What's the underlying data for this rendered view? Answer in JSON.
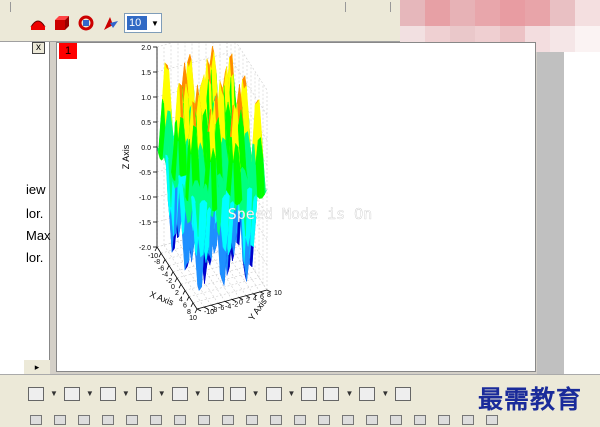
{
  "toolbar": {
    "icons": [
      "rotate-icon",
      "cube-icon",
      "reset-icon",
      "lighting-icon"
    ],
    "size_value": "10"
  },
  "left_panel": {
    "close_label": "x",
    "items": [
      "iew",
      "lor.",
      "Max",
      "lor."
    ]
  },
  "graph": {
    "layer_label": "1",
    "overlay_text": "Speed Mode is On",
    "chart_data": {
      "type": "surface",
      "xlabel": "X Axis",
      "ylabel": "Y Axis",
      "zlabel": "Z Axis",
      "xticks": [
        "-10",
        "-8",
        "-6",
        "-4",
        "-2",
        "0",
        "2",
        "4",
        "6",
        "8",
        "10"
      ],
      "yticks": [
        "-10",
        "-8",
        "-6",
        "-4",
        "-2",
        "0",
        "2",
        "4",
        "6",
        "8",
        "10"
      ],
      "zticks": [
        "-2.0",
        "-1.5",
        "-1.0",
        "-0.5",
        "0.0",
        "0.5",
        "1.0",
        "1.5",
        "2.0"
      ],
      "xlim": [
        -10,
        10
      ],
      "ylim": [
        -10,
        10
      ],
      "zlim": [
        -2,
        2
      ],
      "grid": true,
      "colors": [
        "#0000cc",
        "#1e90ff",
        "#00ffff",
        "#00ff7f",
        "#00ff00",
        "#ffff00",
        "#ff8c00"
      ]
    }
  },
  "watermark": "最需教育"
}
